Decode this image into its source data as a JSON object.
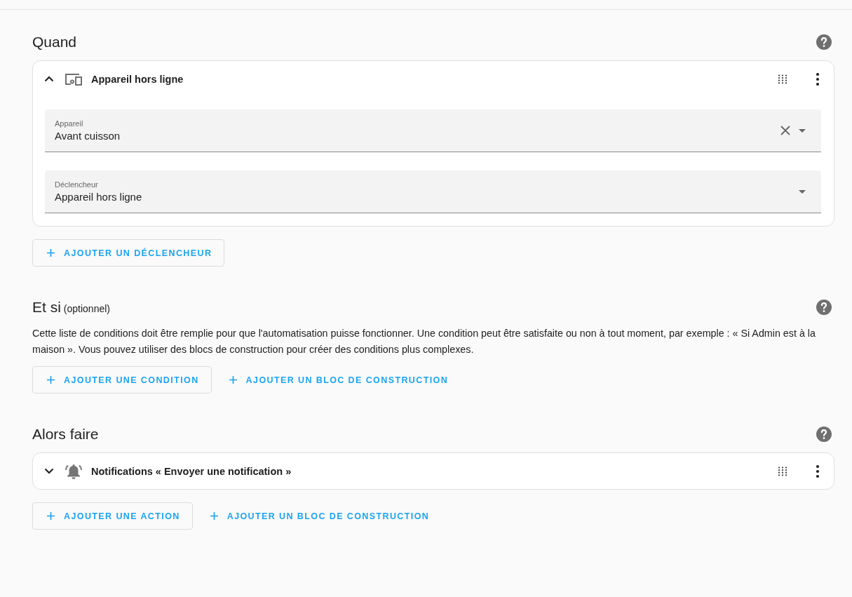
{
  "sections": [
    {
      "title": "Quand",
      "cards": [
        {
          "expanded": true,
          "kind": "device",
          "title": "Appareil hors ligne",
          "fields": [
            {
              "label": "Appareil",
              "value": "Avant cuisson",
              "clearable": true
            },
            {
              "label": "Déclencheur",
              "value": "Appareil hors ligne",
              "clearable": false
            }
          ]
        }
      ],
      "buttons": [
        {
          "kind": "outlined",
          "label": "AJOUTER UN DÉCLENCHEUR"
        }
      ]
    },
    {
      "title": "Et si",
      "note": "(optionnel)",
      "description": "Cette liste de conditions doit être remplie pour que l'automatisation puisse fonctionner. Une condition peut être satisfaite ou non à tout moment, par exemple : « Si Admin est à la maison ». Vous pouvez utiliser des blocs de construction pour créer des conditions plus complexes.",
      "buttons": [
        {
          "kind": "outlined",
          "label": "AJOUTER UNE CONDITION"
        },
        {
          "kind": "text",
          "label": "AJOUTER UN BLOC DE CONSTRUCTION"
        }
      ]
    },
    {
      "title": "Alors faire",
      "cards": [
        {
          "expanded": false,
          "kind": "notification",
          "title": "Notifications « Envoyer une notification »"
        }
      ],
      "buttons": [
        {
          "kind": "outlined",
          "label": "AJOUTER UNE ACTION"
        },
        {
          "kind": "text",
          "label": "AJOUTER UN BLOC DE CONSTRUCTION"
        }
      ]
    }
  ]
}
